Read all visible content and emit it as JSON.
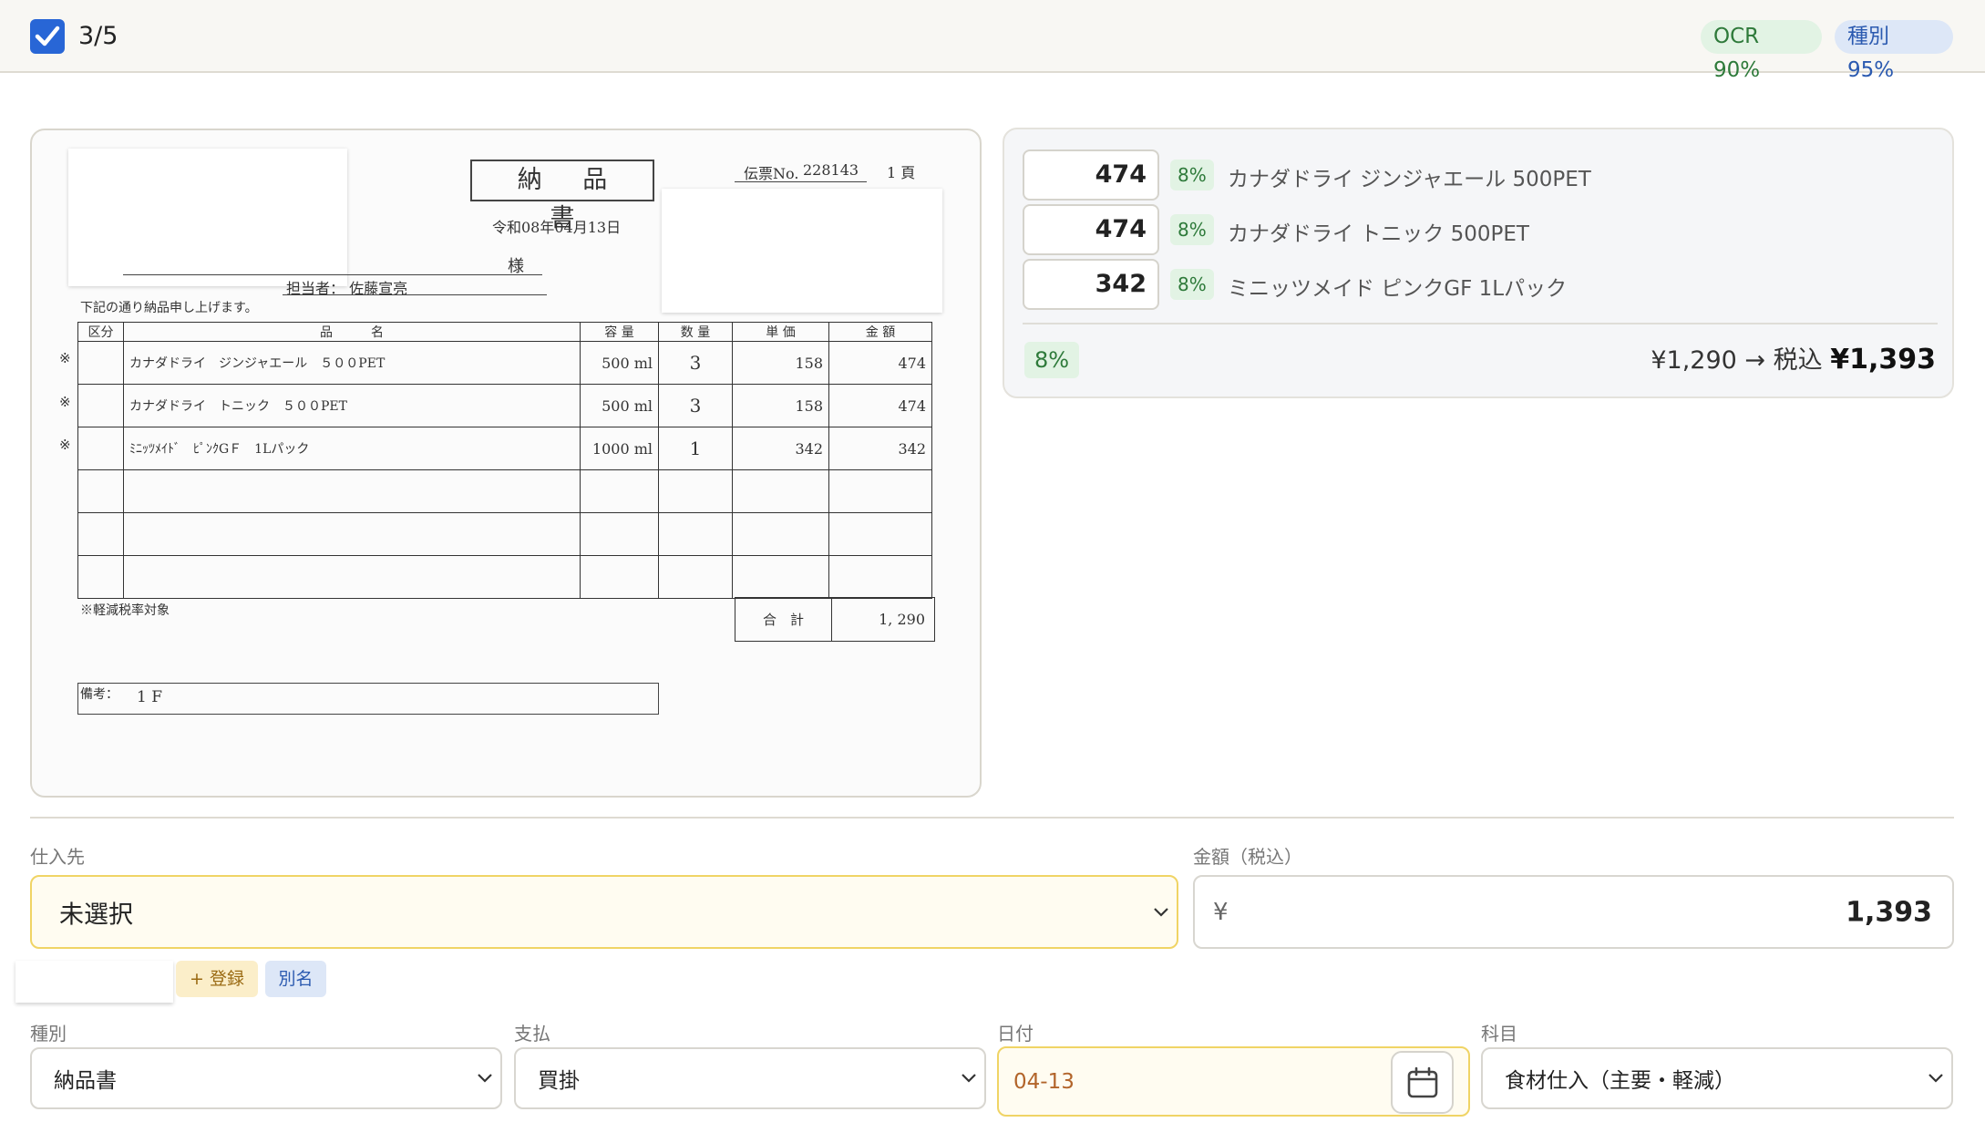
{
  "header": {
    "progress": "3/5",
    "checked": true,
    "ocr_badge": "OCR 90%",
    "kind_badge": "種別 95%"
  },
  "document": {
    "title": "納 品 書",
    "slip_label": "伝票No.",
    "slip_no": "228143",
    "page": "1 頁",
    "date": "令和08年04月13日",
    "honorific": "様",
    "person": "担当者： 佐藤宣亮",
    "intro": "下記の通り納品申し上げます。",
    "columns": [
      "区分",
      "品　　　名",
      "容 量",
      "数 量",
      "単 価",
      "金 額"
    ],
    "rows": [
      {
        "mark": "※",
        "name": "カナダドライ　ジンジャエール　５００PET",
        "volume": "500 ml",
        "qty": "3",
        "unit": "158",
        "amount": "474"
      },
      {
        "mark": "※",
        "name": "カナダドライ　トニック　５００PET",
        "volume": "500 ml",
        "qty": "3",
        "unit": "158",
        "amount": "474"
      },
      {
        "mark": "※",
        "name": "ﾐﾆｯﾂﾒｲﾄﾞ　ﾋﾟﾝｸGＦ　1Lパック",
        "volume": "1000 ml",
        "qty": "1",
        "unit": "342",
        "amount": "342"
      }
    ],
    "reduced_note": "※軽減税率対象",
    "total_label": "合　計",
    "total_value": "1, 290",
    "remarks_label": "備考：",
    "remarks_value": "1 F"
  },
  "items": [
    {
      "amount": "474",
      "tax": "8%",
      "name": "カナダドライ ジンジャエール 500PET"
    },
    {
      "amount": "474",
      "tax": "8%",
      "name": "カナダドライ トニック 500PET"
    },
    {
      "amount": "342",
      "tax": "8%",
      "name": "ミニッツメイド ピンクGF 1Lパック"
    }
  ],
  "summary": {
    "tax": "8%",
    "subtotal": "¥1,290 → 税込",
    "total": "¥1,393"
  },
  "form": {
    "vendor_label": "仕入先",
    "vendor_value": "未選択",
    "amount_label": "金額（税込）",
    "currency": "¥",
    "amount_value": "1,393",
    "register_button": "+ 登録",
    "alias_button": "別名",
    "kind_label": "種別",
    "kind_value": "納品書",
    "payment_label": "支払",
    "payment_value": "買掛",
    "date_label": "日付",
    "date_value": "04-13",
    "account_label": "科目",
    "account_value": "食材仕入（主要・軽減）"
  },
  "colors": {
    "accent": "#2866d6",
    "badge_green": "#2e7a3a",
    "badge_blue": "#2b5ab0",
    "highlight_border": "#f0d465",
    "date_text": "#b2642a"
  }
}
